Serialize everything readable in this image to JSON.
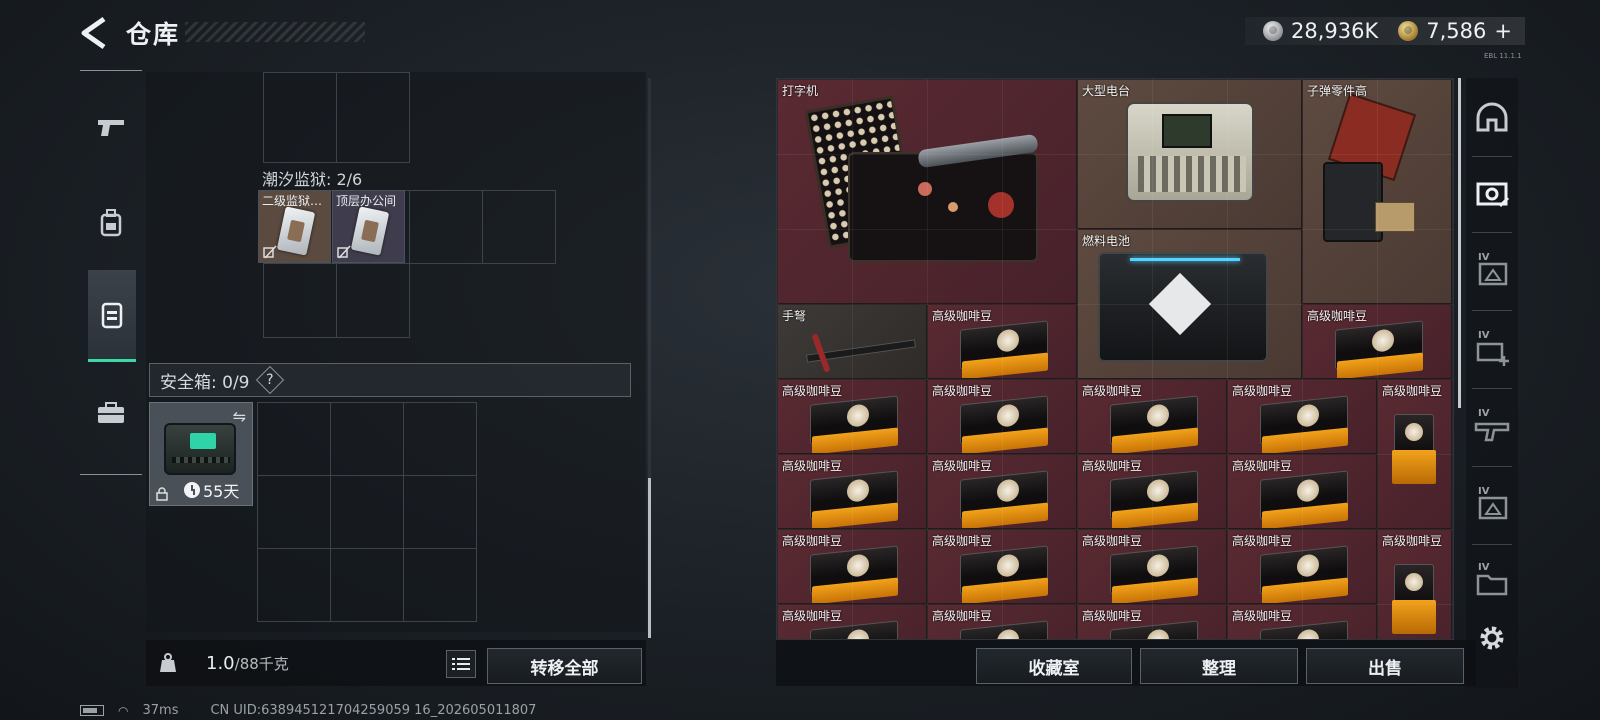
{
  "header": {
    "title": "仓库",
    "back_icon": "chevron-left-icon",
    "currency_silver": "28,936K",
    "currency_gold": "7,586",
    "currency_gold_plus": "+",
    "corner_label": "EBL 11.1.1"
  },
  "left_rail": {
    "tabs": [
      {
        "icon": "pistol-icon",
        "active": false
      },
      {
        "icon": "backpack-icon",
        "active": false
      },
      {
        "icon": "vest-icon",
        "active": true
      },
      {
        "icon": "briefcase-icon",
        "active": false
      }
    ]
  },
  "left_panel": {
    "tidal_prison_label": "潮汐监狱: 2/6",
    "tidal_items": [
      {
        "name": "二级监狱…"
      },
      {
        "name": "顶层办公间"
      }
    ],
    "safebox_label": "安全箱: 0/9",
    "safebox_help": "?",
    "safebox_timer": "55天",
    "weight_value": "1.0",
    "weight_max": "/88千克",
    "transfer_all_button": "转移全部"
  },
  "right_panel": {
    "items": [
      {
        "name": "打字机"
      },
      {
        "name": "大型电台"
      },
      {
        "name": "子弹零件高"
      },
      {
        "name": "燃料电池"
      },
      {
        "name": "手弩"
      },
      {
        "name": "高级咖啡豆"
      }
    ],
    "collection_button": "收藏室",
    "sort_button": "整理",
    "sell_button": "出售"
  },
  "right_rail": {
    "icons": [
      "helmet-icon",
      "camera-repair-icon",
      "tier4-frame-icon",
      "tier4-medkit-icon",
      "tier4-rifle-icon",
      "tier4-frame-icon",
      "tier4-folder-icon",
      "settings-gear-icon"
    ],
    "tier_label": "IV"
  },
  "status_bar": {
    "ping": "37ms",
    "uid": "CN UID:638945121704259059 16_202605011807"
  },
  "colors": {
    "accent_green": "#3ad9a6",
    "maroon_cell": "#5a2a32",
    "gold_band": "#f2a21a"
  }
}
